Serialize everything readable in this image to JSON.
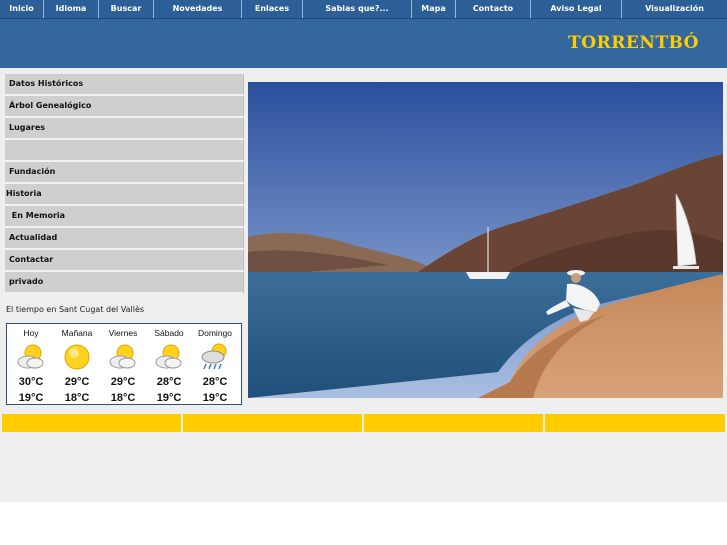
{
  "nav": {
    "items": [
      "Inicio",
      "Idioma",
      "Buscar",
      "Novedades",
      "Enlaces",
      "Sabias que?...",
      "Mapa",
      "Contacto",
      "Aviso Legal",
      "Visualización"
    ]
  },
  "header": {
    "title": "TORRENTBÓ"
  },
  "sidebar": {
    "items": [
      "Datos Históricos",
      "Árbol Genealógico",
      "Lugares",
      "",
      "Fundación",
      "Historia",
      " En Memoria",
      "Actualidad",
      "Contactar",
      "privado"
    ]
  },
  "weather": {
    "caption": "El tiempo en Sant Cugat del Vallès",
    "days": [
      {
        "name": "Hoy",
        "icon": "sun-cloud-icon",
        "high": "30°C",
        "low": "19°C"
      },
      {
        "name": "Mañana",
        "icon": "sun-icon",
        "high": "29°C",
        "low": "18°C"
      },
      {
        "name": "Viernes",
        "icon": "sun-cloud-icon",
        "high": "29°C",
        "low": "18°C"
      },
      {
        "name": "Sábado",
        "icon": "sun-cloud-icon",
        "high": "28°C",
        "low": "19°C"
      },
      {
        "name": "Domingo",
        "icon": "sun-cloud-rain-icon",
        "high": "28°C",
        "low": "19°C"
      }
    ]
  },
  "colors": {
    "nav_bg": "#2c5f98",
    "banner_bg": "#34679d",
    "title_color": "#ffcc00",
    "footer_bar": "#ffcc00"
  }
}
